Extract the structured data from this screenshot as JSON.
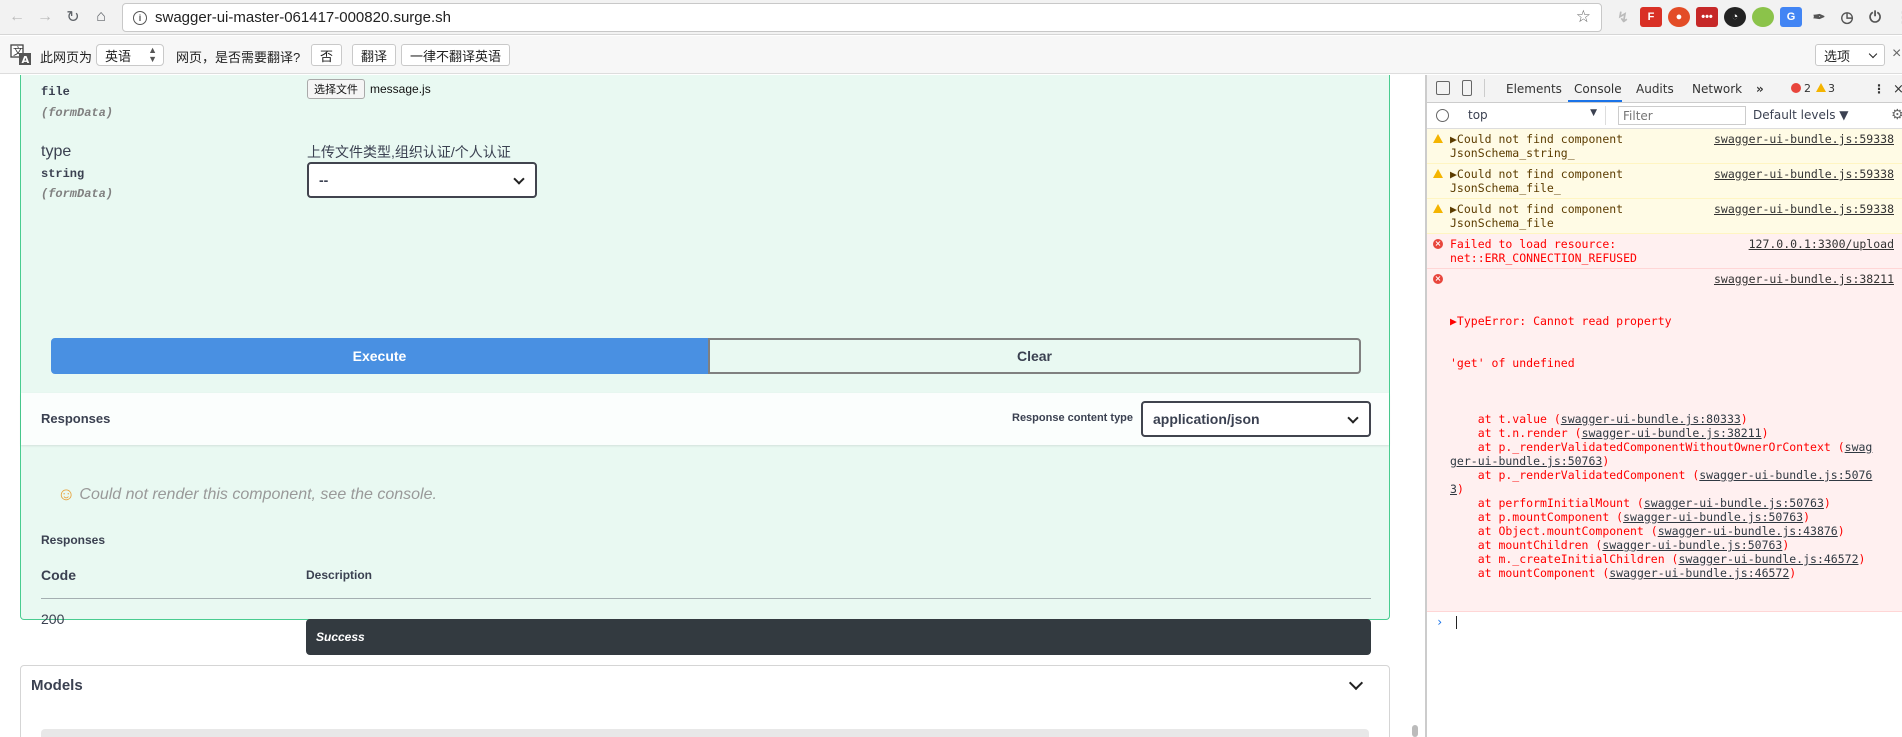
{
  "browser": {
    "url": "swagger-ui-master-061417-000820.surge.sh"
  },
  "translate": {
    "prefix": "此网页为",
    "language": "英语",
    "question": "网页，是否需要翻译?",
    "no": "否",
    "translate": "翻译",
    "never": "一律不翻译英语",
    "options": "选项"
  },
  "swagger": {
    "file_param": {
      "name": "file",
      "in": "(formData)",
      "choose_file": "选择文件",
      "file_name": "message.js"
    },
    "type_param": {
      "name": "type",
      "type": "string",
      "in": "(formData)",
      "description": "上传文件类型,组织认证/个人认证",
      "selected": "--"
    },
    "execute": "Execute",
    "clear": "Clear",
    "responses_title": "Responses",
    "content_type_label": "Response content type",
    "content_type_value": "application/json",
    "render_error": "Could not render this component, see the console.",
    "responses_subtitle": "Responses",
    "table": {
      "col_code": "Code",
      "col_description": "Description",
      "rows": [
        {
          "code": "200",
          "description": "Success"
        }
      ]
    },
    "models_title": "Models"
  },
  "devtools": {
    "tabs": [
      "Elements",
      "Console",
      "Audits",
      "Network"
    ],
    "active_tab": "Console",
    "error_count": "2",
    "warning_count": "3",
    "context": "top",
    "filter_placeholder": "Filter",
    "levels": "Default levels ▼",
    "messages": [
      {
        "level": "warn",
        "text1": "▶Could not find component",
        "text2": "JsonSchema_string_",
        "source": "swagger-ui-bundle.js:59338"
      },
      {
        "level": "warn",
        "text1": "▶Could not find component",
        "text2": "JsonSchema_file_",
        "source": "swagger-ui-bundle.js:59338"
      },
      {
        "level": "warn",
        "text1": "▶Could not find component",
        "text2": "JsonSchema_file",
        "source": "swagger-ui-bundle.js:59338"
      },
      {
        "level": "error",
        "text1": "Failed to load resource:",
        "text2": "net::ERR_CONNECTION_REFUSED",
        "source": "127.0.0.1:3300/upload"
      }
    ],
    "type_error": {
      "head1": "▶TypeError: Cannot read property",
      "head2": "'get' of undefined",
      "source": "swagger-ui-bundle.js:38211",
      "stack": [
        {
          "fn": "    at t.value (",
          "link": "swagger-ui-bundle.js:80333",
          "tail": ")"
        },
        {
          "fn": "    at t.n.render (",
          "link": "swagger-ui-bundle.js:38211",
          "tail": ")"
        },
        {
          "fn": "    at p._renderValidatedComponentWithoutOwnerOrContext (",
          "link": "swag",
          "tail": ""
        },
        {
          "fn": "",
          "link": "ger-ui-bundle.js:50763",
          "tail": ")"
        },
        {
          "fn": "    at p._renderValidatedComponent (",
          "link": "swagger-ui-bundle.js:5076",
          "tail": ""
        },
        {
          "fn": "",
          "link": "3",
          "tail": ")"
        },
        {
          "fn": "    at performInitialMount (",
          "link": "swagger-ui-bundle.js:50763",
          "tail": ")"
        },
        {
          "fn": "    at p.mountComponent (",
          "link": "swagger-ui-bundle.js:50763",
          "tail": ")"
        },
        {
          "fn": "    at Object.mountComponent (",
          "link": "swagger-ui-bundle.js:43876",
          "tail": ")"
        },
        {
          "fn": "    at mountChildren (",
          "link": "swagger-ui-bundle.js:50763",
          "tail": ")"
        },
        {
          "fn": "    at m._createInitialChildren (",
          "link": "swagger-ui-bundle.js:46572",
          "tail": ")"
        },
        {
          "fn": "    at mountComponent (",
          "link": "swagger-ui-bundle.js:46572",
          "tail": ")"
        }
      ]
    },
    "prompt": "›"
  }
}
